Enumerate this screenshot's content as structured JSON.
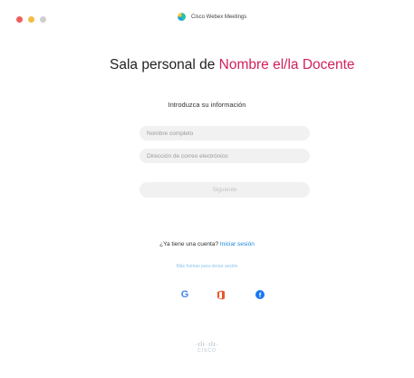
{
  "window": {
    "app_title": "Cisco Webex Meetings",
    "app_icon": "webex-logo-icon",
    "traffic_lights": [
      "close",
      "minimize",
      "zoom"
    ]
  },
  "main": {
    "heading_prefix": "Sala personal de ",
    "heading_name": "Nombre el/la Docente",
    "subheading": "Introduzca su información",
    "name_placeholder": "Nombre completo",
    "email_placeholder": "Dirección de correo electrónico",
    "next_button": "Siguiente",
    "account_question": "¿Ya tiene una cuenta?",
    "signin_link": "Iniciar sesión",
    "alt_signin": "Más formas para iniciar sesión",
    "social": [
      "google-icon",
      "office-icon",
      "facebook-icon"
    ]
  },
  "footer": {
    "logo_text": "CISCO"
  },
  "colors": {
    "accent_pink": "#d2215c",
    "link_blue": "#1a87d8",
    "field_bg": "#f1f1f1"
  }
}
